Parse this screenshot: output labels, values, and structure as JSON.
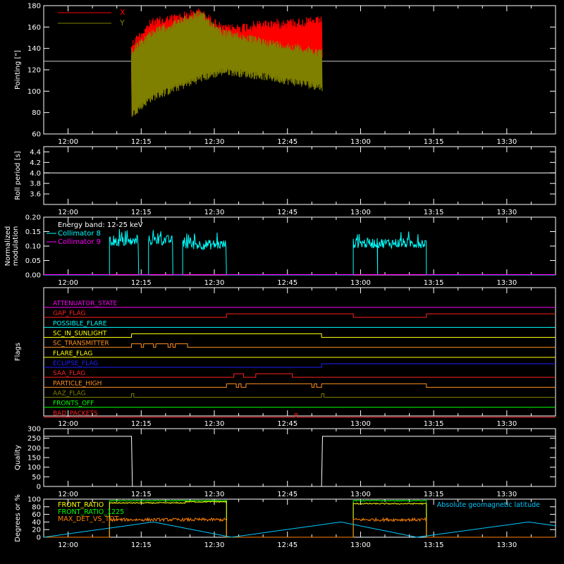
{
  "time_axis": {
    "tick_labels": [
      "12:00",
      "12:15",
      "12:30",
      "12:45",
      "13:00",
      "13:15",
      "13:30"
    ],
    "start_minute": 715,
    "end_minute": 820,
    "minor_step_min": 5
  },
  "colors": {
    "background": "#000000",
    "axis": "#ffffff",
    "x_pointing": "#ff0000",
    "y_pointing": "#808000",
    "coll8": "#00ffff",
    "coll9": "#ff00ff",
    "front_ratio": "#00ff00",
    "front_ratio_1225": "#ffff00",
    "max_det": "#ff8000",
    "geomag": "#00c8ff"
  },
  "chart_data": [
    {
      "type": "line",
      "ylabel": "Pointing [\"]",
      "ylim": [
        60,
        180
      ],
      "yticks": [
        60,
        80,
        100,
        120,
        140,
        160,
        180
      ],
      "legend": [
        "X",
        "Y"
      ],
      "legend_position": "top-left",
      "reference_line": 128,
      "data_range_minutes": [
        733,
        772
      ],
      "x_envelope": {
        "t": [
          733,
          737,
          747,
          752,
          760,
          772
        ],
        "upper": [
          148,
          168,
          178,
          162,
          167,
          170
        ],
        "lower": [
          75,
          108,
          124,
          120,
          126,
          123
        ]
      },
      "y_envelope": {
        "t": [
          733,
          737,
          747,
          752,
          760,
          772
        ],
        "upper": [
          140,
          158,
          176,
          158,
          150,
          140
        ],
        "lower": [
          75,
          90,
          108,
          115,
          110,
          100
        ]
      }
    },
    {
      "type": "line",
      "ylabel": "Roll period [s]",
      "ylim": [
        3.4,
        4.5
      ],
      "yticks": [
        3.6,
        3.8,
        4.0,
        4.2,
        4.4
      ],
      "x": [
        715,
        820
      ],
      "y": [
        4.0,
        4.0
      ]
    },
    {
      "type": "line",
      "ylabel": "Normalized modulation",
      "ylim": [
        0,
        0.2
      ],
      "yticks": [
        "0.00",
        "0.05",
        "0.10",
        "0.15",
        "0.20"
      ],
      "annotation": "Energy band: 12-25 keV",
      "series": [
        {
          "name": "Collimator 8",
          "segments": [
            [
              728.5,
              734.5,
              0.115
            ],
            [
              736.5,
              741.5,
              0.12
            ],
            [
              743.5,
              752.5,
              0.105
            ],
            [
              778.5,
              783.5,
              0.11
            ],
            [
              783.5,
              793.5,
              0.11
            ]
          ]
        },
        {
          "name": "Collimator 9",
          "constant": 0.0
        }
      ],
      "legend_position": "top-left"
    },
    {
      "type": "table",
      "ylabel": "Flags",
      "flags": [
        {
          "name": "ATTENUATOR_STATE",
          "color": "#ff00ff",
          "changes": []
        },
        {
          "name": "GAP_FLAG",
          "color": "#ff2020",
          "changes": [
            [
              752.5,
              1
            ],
            [
              778.5,
              0
            ],
            [
              793.5,
              1
            ]
          ]
        },
        {
          "name": "POSSIBLE_FLARE",
          "color": "#00ffff",
          "changes": []
        },
        {
          "name": "SC_IN_SUNLIGHT",
          "color": "#ffff00",
          "changes": [
            [
              733,
              1
            ],
            [
              772,
              0
            ]
          ]
        },
        {
          "name": "SC_TRANSMITTER",
          "color": "#ff9020",
          "changes": [
            [
              733,
              1
            ],
            [
              735,
              0
            ],
            [
              735.5,
              1
            ],
            [
              737.5,
              0
            ],
            [
              738,
              1
            ],
            [
              740.5,
              0
            ],
            [
              741,
              1
            ],
            [
              741.5,
              0
            ],
            [
              742,
              1
            ],
            [
              744.5,
              0
            ]
          ]
        },
        {
          "name": "FLARE_FLAG",
          "color": "#ffff00",
          "changes": []
        },
        {
          "name": "ECLIPSE_FLAG",
          "color": "#2020ff",
          "changes": [
            [
              733,
              0
            ],
            [
              772,
              1
            ]
          ]
        },
        {
          "name": "SAA_FLAG",
          "color": "#ff2020",
          "changes": [
            [
              754,
              1
            ],
            [
              756,
              0
            ],
            [
              758.5,
              1
            ],
            [
              766,
              0
            ]
          ]
        },
        {
          "name": "PARTICLE_HIGH",
          "color": "#ff9020",
          "changes": [
            [
              752.5,
              1
            ],
            [
              754.5,
              0
            ],
            [
              755,
              1
            ],
            [
              755.5,
              0
            ],
            [
              756.5,
              1
            ],
            [
              770,
              0
            ],
            [
              770.5,
              1
            ],
            [
              771,
              0
            ],
            [
              772,
              1
            ],
            [
              793.5,
              0
            ]
          ]
        },
        {
          "name": "AAZ_FLAG",
          "color": "#808000",
          "changes": [
            [
              733,
              1
            ],
            [
              733.5,
              0
            ],
            [
              772,
              1
            ],
            [
              772.5,
              0
            ]
          ]
        },
        {
          "name": "FRONTS_OFF",
          "color": "#00ff00",
          "changes": []
        },
        {
          "name": "BAD_PACKETS",
          "color": "#ff2020",
          "changes": [
            [
              766.5,
              1
            ],
            [
              767,
              0
            ]
          ]
        }
      ]
    },
    {
      "type": "line",
      "ylabel": "Quality",
      "ylim": [
        0,
        300
      ],
      "yticks": [
        0,
        50,
        100,
        150,
        200,
        250,
        300
      ],
      "x": [
        715,
        733,
        733.2,
        772,
        772.2,
        820
      ],
      "y": [
        260,
        260,
        0,
        0,
        260,
        260
      ]
    },
    {
      "type": "line",
      "ylabel": "Degrees or %",
      "ylim": [
        0,
        100
      ],
      "yticks": [
        0,
        20,
        40,
        60,
        80,
        100
      ],
      "series": [
        {
          "name": "FRONT_RATIO",
          "segments": [
            [
              728.5,
              752.5,
              96
            ],
            [
              778.5,
              793.5,
              96
            ]
          ]
        },
        {
          "name": "FRONT_RATIO_1225",
          "segments": [
            [
              728.5,
              752.5,
              90
            ],
            [
              778.5,
              793.5,
              88
            ]
          ]
        },
        {
          "name": "MAX_DET_VS_TOT",
          "segments": [
            [
              728.5,
              752.5,
              46
            ],
            [
              778.5,
              793.5,
              46
            ]
          ]
        },
        {
          "name": "Absolute geomagnetic latitude",
          "x": [
            715,
            737.5,
            753.5,
            776,
            791.5,
            814.5,
            820
          ],
          "y": [
            0,
            40,
            0,
            40,
            0,
            40,
            30
          ]
        }
      ],
      "legend_position": "top-left"
    }
  ]
}
